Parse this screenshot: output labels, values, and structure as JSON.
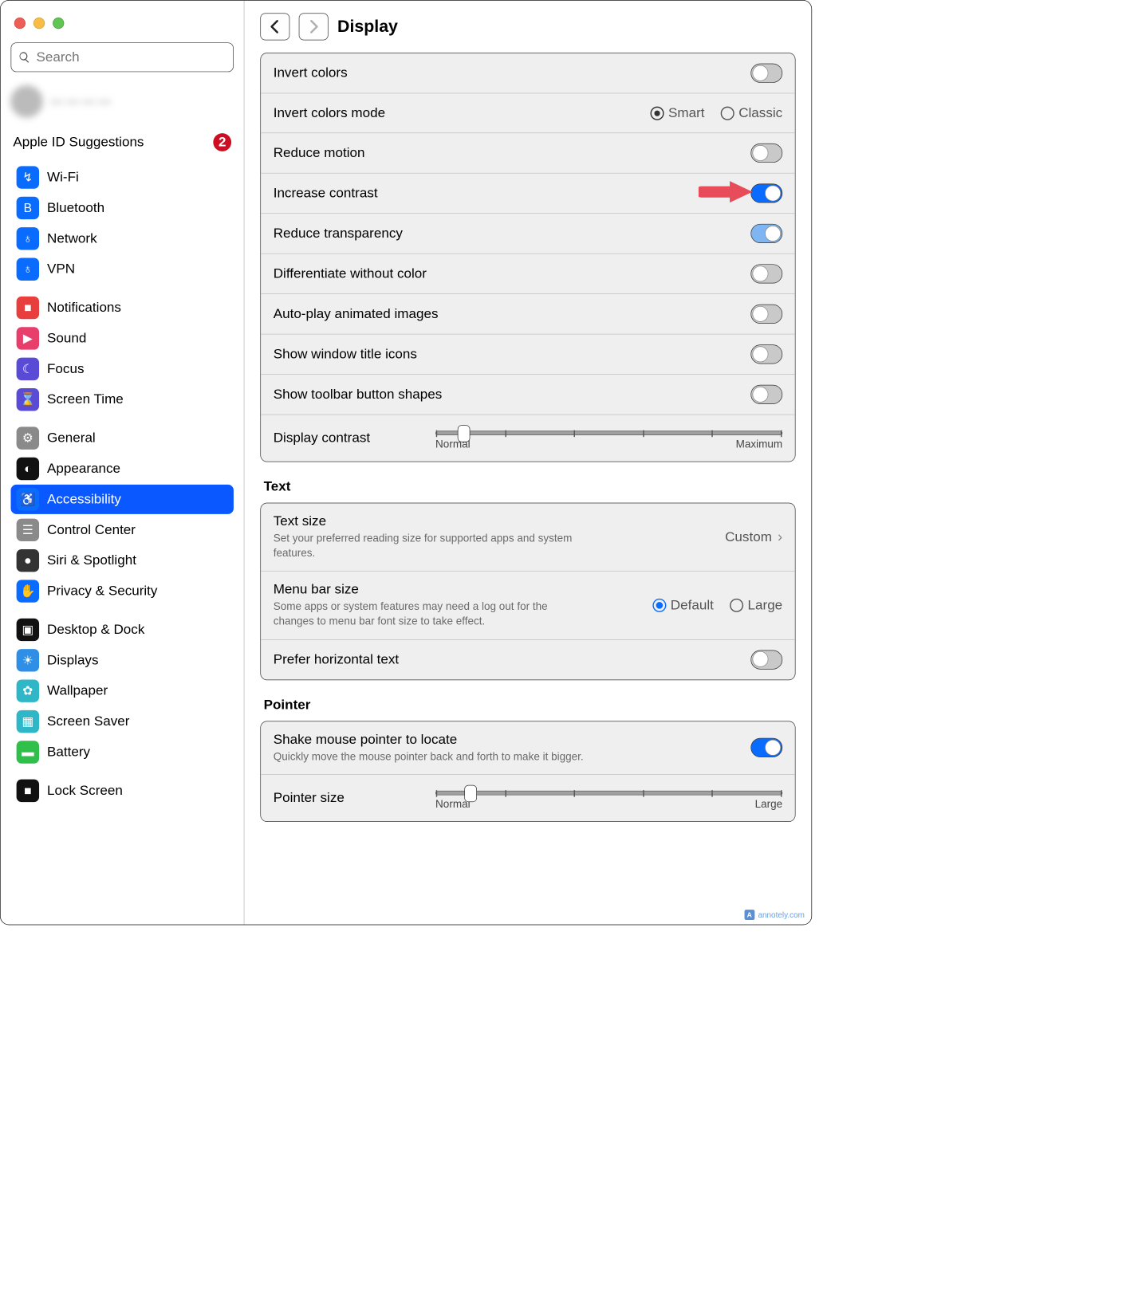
{
  "window": {
    "title": "Display"
  },
  "sidebar": {
    "search_placeholder": "Search",
    "profile": "— — — —",
    "suggestions_label": "Apple ID Suggestions",
    "suggestions_badge": "2",
    "groups": [
      [
        {
          "label": "Wi-Fi",
          "icon": "wifi-icon",
          "color": "#0a6cff"
        },
        {
          "label": "Bluetooth",
          "icon": "bluetooth-icon",
          "color": "#0a6cff"
        },
        {
          "label": "Network",
          "icon": "network-icon",
          "color": "#0a6cff"
        },
        {
          "label": "VPN",
          "icon": "vpn-icon",
          "color": "#0a6cff"
        }
      ],
      [
        {
          "label": "Notifications",
          "icon": "bell-icon",
          "color": "#e83e3e"
        },
        {
          "label": "Sound",
          "icon": "sound-icon",
          "color": "#e83e6b"
        },
        {
          "label": "Focus",
          "icon": "moon-icon",
          "color": "#5a4bd6"
        },
        {
          "label": "Screen Time",
          "icon": "hourglass-icon",
          "color": "#5a4bd6"
        }
      ],
      [
        {
          "label": "General",
          "icon": "gear-icon",
          "color": "#8a8a8a"
        },
        {
          "label": "Appearance",
          "icon": "appearance-icon",
          "color": "#111"
        },
        {
          "label": "Accessibility",
          "icon": "accessibility-icon",
          "color": "#0a6cff",
          "selected": true
        },
        {
          "label": "Control Center",
          "icon": "sliders-icon",
          "color": "#8a8a8a"
        },
        {
          "label": "Siri & Spotlight",
          "icon": "siri-icon",
          "color": "#333"
        },
        {
          "label": "Privacy & Security",
          "icon": "hand-icon",
          "color": "#0a6cff"
        }
      ],
      [
        {
          "label": "Desktop & Dock",
          "icon": "dock-icon",
          "color": "#111"
        },
        {
          "label": "Displays",
          "icon": "displays-icon",
          "color": "#2f8fe6"
        },
        {
          "label": "Wallpaper",
          "icon": "wallpaper-icon",
          "color": "#2fb7c7"
        },
        {
          "label": "Screen Saver",
          "icon": "screensaver-icon",
          "color": "#2fb7c7"
        },
        {
          "label": "Battery",
          "icon": "battery-icon",
          "color": "#2fbf4a"
        }
      ],
      [
        {
          "label": "Lock Screen",
          "icon": "lock-icon",
          "color": "#111"
        }
      ]
    ]
  },
  "main": {
    "rows_display": [
      {
        "label": "Invert colors",
        "control": "toggle",
        "on": false
      },
      {
        "label": "Invert colors mode",
        "control": "radio",
        "options": [
          "Smart",
          "Classic"
        ],
        "selected": "Smart",
        "style": "gray"
      },
      {
        "label": "Reduce motion",
        "control": "toggle",
        "on": false
      },
      {
        "label": "Increase contrast",
        "control": "toggle",
        "on": true,
        "annot_arrow": true
      },
      {
        "label": "Reduce transparency",
        "control": "toggle",
        "on": true,
        "light": true
      },
      {
        "label": "Differentiate without color",
        "control": "toggle",
        "on": false
      },
      {
        "label": "Auto-play animated images",
        "control": "toggle",
        "on": false
      },
      {
        "label": "Show window title icons",
        "control": "toggle",
        "on": false
      },
      {
        "label": "Show toolbar button shapes",
        "control": "toggle",
        "on": false
      },
      {
        "label": "Display contrast",
        "control": "slider",
        "min_label": "Normal",
        "max_label": "Maximum",
        "value": 0.08
      }
    ],
    "text_section_title": "Text",
    "rows_text": [
      {
        "label": "Text size",
        "sub": "Set your preferred reading size for supported apps and system features.",
        "control": "link",
        "value": "Custom"
      },
      {
        "label": "Menu bar size",
        "sub": "Some apps or system features may need a log out for the changes to menu bar font size to take effect.",
        "control": "radio",
        "options": [
          "Default",
          "Large"
        ],
        "selected": "Default",
        "style": "blue"
      },
      {
        "label": "Prefer horizontal text",
        "control": "toggle",
        "on": false
      }
    ],
    "pointer_section_title": "Pointer",
    "rows_pointer": [
      {
        "label": "Shake mouse pointer to locate",
        "sub": "Quickly move the mouse pointer back and forth to make it bigger.",
        "control": "toggle",
        "on": true
      },
      {
        "label": "Pointer size",
        "control": "slider",
        "min_label": "Normal",
        "max_label": "Large",
        "value": 0.1
      }
    ]
  },
  "watermark": "annotely.com"
}
